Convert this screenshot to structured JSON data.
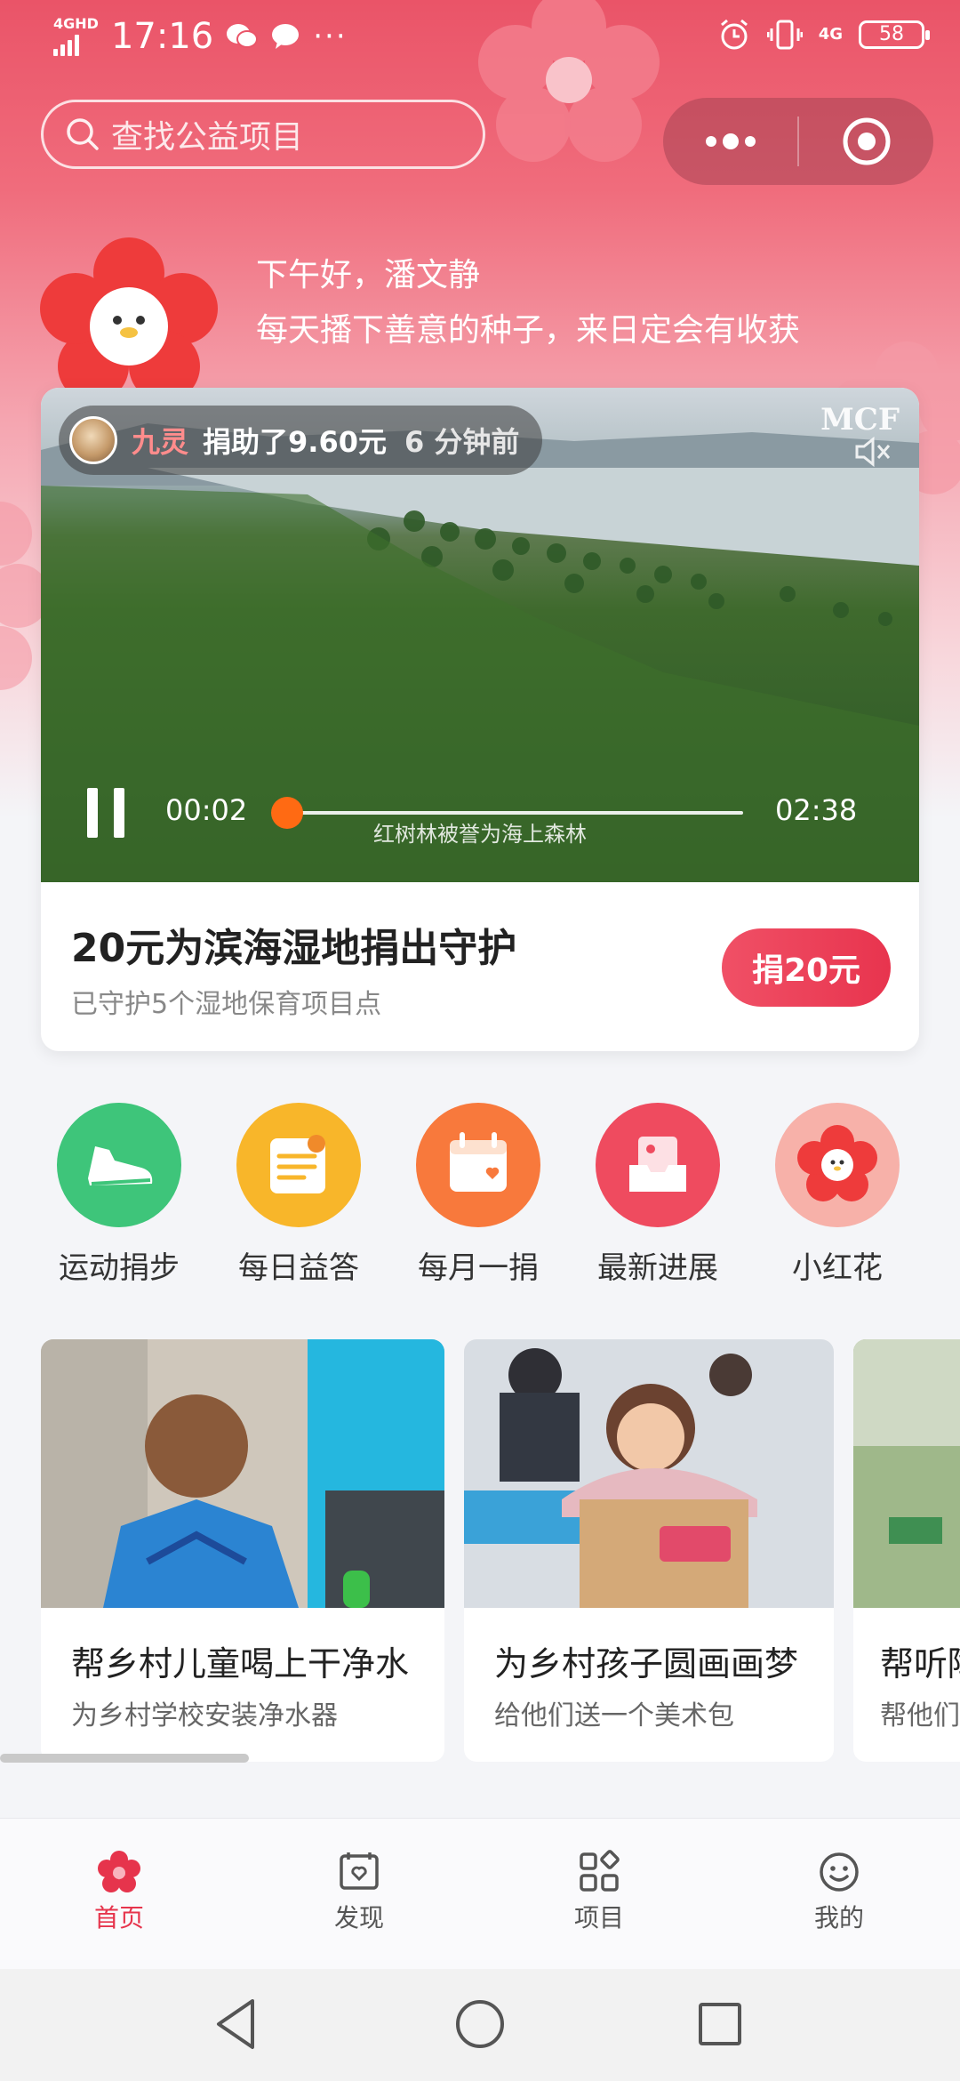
{
  "status_bar": {
    "network": "4GHD",
    "time": "17:16",
    "battery": "58",
    "signal_right": "4G"
  },
  "search": {
    "placeholder": "查找公益项目"
  },
  "greeting": {
    "line1": "下午好，潘文静",
    "line2": "每天播下善意的种子，来日定会有收获"
  },
  "video": {
    "donor_name": "九灵",
    "donor_action": "捐助了9.60元",
    "donor_time": "6 分钟前",
    "logo_text": "MCF",
    "current_time": "00:02",
    "total_time": "02:38",
    "progress": 0.013,
    "caption": "红树林被誉为海上森林"
  },
  "featured": {
    "title": "20元为滨海湿地捐出守护",
    "subtitle": "已守护5个湿地保育项目点",
    "button": "捐20元"
  },
  "quick_links": [
    {
      "label": "运动捐步",
      "icon": "sneaker-icon",
      "color": "#3ec57a"
    },
    {
      "label": "每日益答",
      "icon": "quiz-icon",
      "color": "#f8b62a"
    },
    {
      "label": "每月一捐",
      "icon": "calendar-icon",
      "color": "#f8793c"
    },
    {
      "label": "最新进展",
      "icon": "inbox-icon",
      "color": "#ef4b5f"
    },
    {
      "label": "小红花",
      "icon": "red-flower-icon",
      "color": "#f7b1a9"
    }
  ],
  "projects": [
    {
      "title": "帮乡村儿童喝上干净水",
      "subtitle": "为乡村学校安装净水器"
    },
    {
      "title": "为乡村孩子圆画画梦",
      "subtitle": "给他们送一个美术包"
    },
    {
      "title": "帮听障",
      "subtitle": "帮他们"
    }
  ],
  "tabs": [
    {
      "label": "首页",
      "icon": "flower-home-icon",
      "active": true
    },
    {
      "label": "发现",
      "icon": "discover-icon",
      "active": false
    },
    {
      "label": "项目",
      "icon": "grid-icon",
      "active": false
    },
    {
      "label": "我的",
      "icon": "smiley-icon",
      "active": false
    }
  ],
  "colors": {
    "accent": "#e6344c",
    "brand_gradient_top": "#ea5468",
    "progress_knob": "#ff6a13"
  }
}
